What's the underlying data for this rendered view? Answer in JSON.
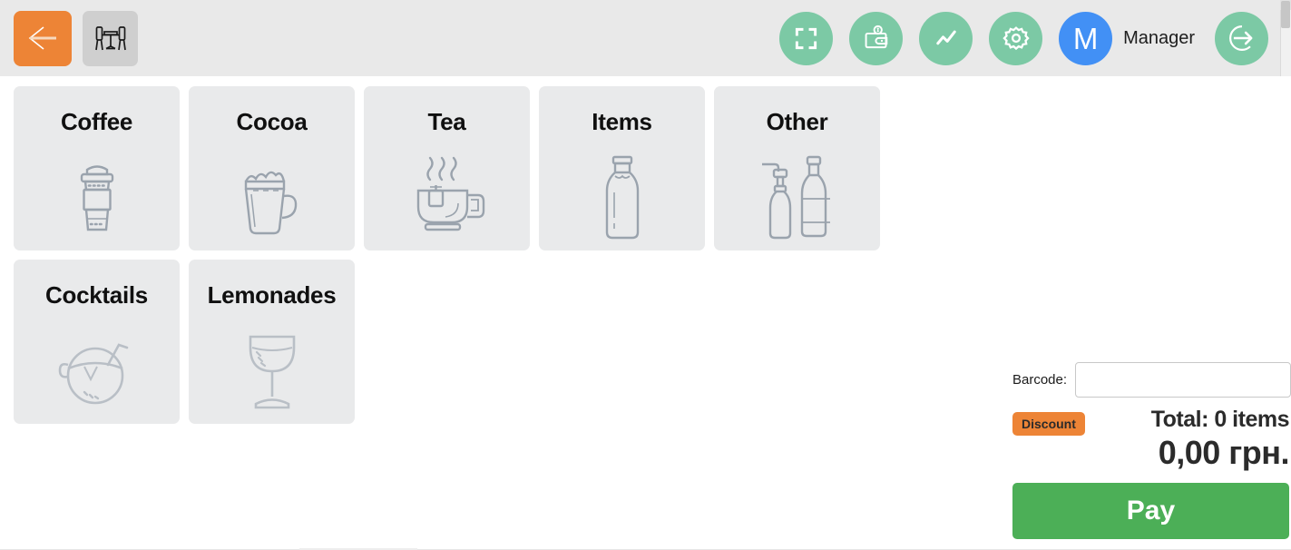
{
  "header": {
    "back_button": {
      "icon": "arrow-left-icon",
      "color": "#ED8436"
    },
    "tables_button": {
      "icon": "table-chairs-icon",
      "color": "#CFCFCF"
    },
    "actions": [
      {
        "name": "fullscreen",
        "icon": "fullscreen-icon",
        "color": "#7CC9A5"
      },
      {
        "name": "cash",
        "icon": "wallet-cash-icon",
        "color": "#7CC9A5"
      },
      {
        "name": "reports",
        "icon": "line-chart-icon",
        "color": "#7CC9A5"
      },
      {
        "name": "settings",
        "icon": "gear-icon",
        "color": "#7CC9A5"
      }
    ],
    "user": {
      "avatar_letter": "M",
      "name": "Manager",
      "avatar_color": "#4290F5"
    },
    "logout": {
      "icon": "logout-icon",
      "color": "#7CC9A5"
    }
  },
  "categories": [
    {
      "label": "Coffee",
      "icon": "coffee-cup-icon"
    },
    {
      "label": "Cocoa",
      "icon": "cocoa-mug-icon"
    },
    {
      "label": "Tea",
      "icon": "tea-cup-icon"
    },
    {
      "label": "Items",
      "icon": "milk-bottle-icon"
    },
    {
      "label": "Other",
      "icon": "syrup-bottles-icon"
    },
    {
      "label": "Cocktails",
      "icon": "coconut-cocktail-icon"
    },
    {
      "label": "Lemonades",
      "icon": "lemonade-glass-icon"
    }
  ],
  "checkout": {
    "barcode_label": "Barcode:",
    "barcode_value": "",
    "barcode_placeholder": "",
    "discount_label": "Discount",
    "total_items": "Total: 0 items",
    "total_amount": "0,00 грн.",
    "pay_label": "Pay",
    "accent_orange": "#ED8436",
    "pay_green": "#4CAF57"
  }
}
